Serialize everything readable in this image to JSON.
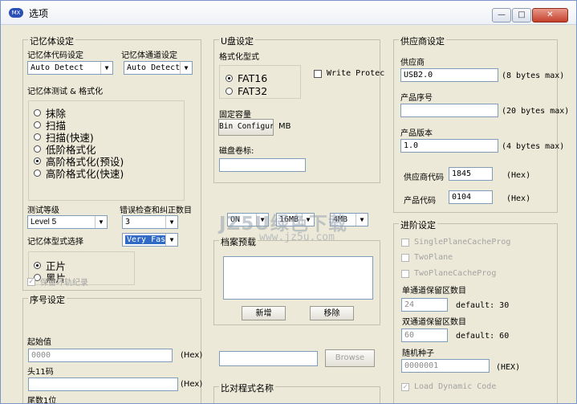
{
  "window": {
    "title": "选项",
    "icon": "MX",
    "min": "—",
    "max": "□",
    "close": "✕"
  },
  "memory": {
    "group_title": "记忆体设定",
    "code_label": "记忆体代码设定",
    "code_value": "Auto Detect",
    "channel_label": "记忆体通道设定",
    "channel_value": "Auto Detect",
    "test_label": "记忆体测试 & 格式化",
    "options": [
      "抹除",
      "扫描",
      "扫描(快速)",
      "低阶格式化",
      "高阶格式化(预设)",
      "高阶格式化(快速)"
    ],
    "selected_index": 4,
    "level_label": "测试等级",
    "level_value": "Level 5",
    "ecc_label": "错误检查和纠正数目",
    "ecc_value": "3",
    "type_label": "记忆体型式选择",
    "type_value": "Very Fast",
    "side_options": [
      "正片",
      "黑片"
    ],
    "side_selected": 0,
    "keep_bad": "保留坏轨纪录"
  },
  "serial": {
    "group_title": "序号设定",
    "start_label": "起始值",
    "start_value": "0000",
    "start_unit": "(Hex)",
    "head_label": "头11码",
    "head_unit": "(Hex)",
    "partial_label": "尾数1位"
  },
  "udisk": {
    "group_title": "U盘设定",
    "format_label": "格式化型式",
    "fs_options": [
      "FAT16",
      "FAT32"
    ],
    "fs_selected": 0,
    "write_protect": "Write Protec",
    "capacity_label": "固定容量",
    "capacity_button": "Bin Configur",
    "capacity_unit": "MB",
    "volume_label": "磁盘卷标:",
    "extra1": "ON",
    "extra2": "16MB",
    "extra3": "4MB"
  },
  "archive": {
    "group_title": "档案预载",
    "add_button": "新增",
    "remove_button": "移除",
    "browse_button": "Browse"
  },
  "compare": {
    "group_title": "比对程式名称"
  },
  "vendor": {
    "group_title": "供应商设定",
    "vendor_label": "供应商",
    "vendor_value": "USB2.0",
    "vendor_hint": "(8 bytes max)",
    "product_label": "产品序号",
    "product_hint": "(20 bytes max)",
    "version_label": "产品版本",
    "version_value": "1.0",
    "version_hint": "(4 bytes max)",
    "vid_label": "供应商代码",
    "vid_value": "1845",
    "vid_unit": "(Hex)",
    "pid_label": "产品代码",
    "pid_value": "0104",
    "pid_unit": "(Hex)"
  },
  "advanced": {
    "group_title": "进阶设定",
    "opts": [
      "SinglePlaneCacheProg",
      "TwoPlane",
      "TwoPlaneCacheProg"
    ],
    "single_label": "单通道保留区数目",
    "single_value": "24",
    "single_default": "default: 30",
    "dual_label": "双通道保留区数目",
    "dual_value": "60",
    "dual_default": "default: 60",
    "seed_label": "随机种子",
    "seed_value": "0000001",
    "seed_unit": "(HEX)",
    "load_dynamic": "Load Dynamic Code"
  },
  "watermark": {
    "line1": "JZ5U绿色下载",
    "line2": "www.jz5u.com"
  }
}
